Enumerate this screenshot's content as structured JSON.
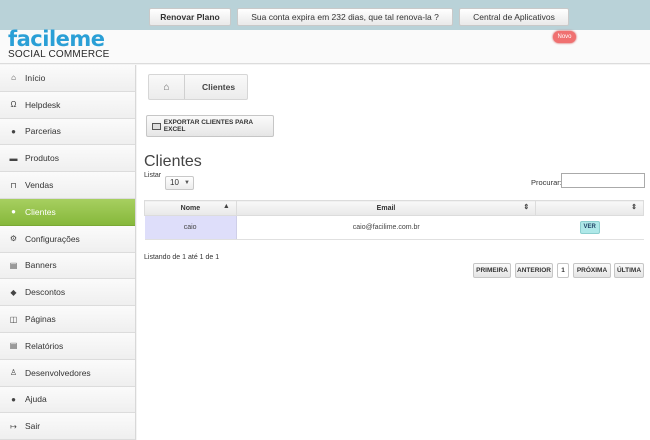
{
  "logo": {
    "main": "facileme",
    "sub": "SOCIAL COMMERCE"
  },
  "header": {
    "plan_button": "Renovar Plano",
    "expira_button": "Sua conta expira em 232 dias, que tal renova-la ?",
    "apps_button": "Central de Aplicativos",
    "new_badge": "Novo"
  },
  "sidebar": {
    "items": [
      {
        "label": "Início",
        "icon": "home-icon"
      },
      {
        "label": "Helpdesk",
        "icon": "headphones-icon"
      },
      {
        "label": "Parcerias",
        "icon": "info-icon"
      },
      {
        "label": "Produtos",
        "icon": "folder-icon"
      },
      {
        "label": "Vendas",
        "icon": "cart-icon"
      },
      {
        "label": "Clientes",
        "icon": "users-icon",
        "active": true
      },
      {
        "label": "Configurações",
        "icon": "gears-icon"
      },
      {
        "label": "Banners",
        "icon": "banner-icon"
      },
      {
        "label": "Descontos",
        "icon": "tag-icon"
      },
      {
        "label": "Páginas",
        "icon": "pages-icon"
      },
      {
        "label": "Relatórios",
        "icon": "report-icon"
      },
      {
        "label": "Desenvolvedores",
        "icon": "developer-icon"
      },
      {
        "label": "Ajuda",
        "icon": "help-icon"
      },
      {
        "label": "Sair",
        "icon": "exit-icon"
      }
    ]
  },
  "breadcrumb": {
    "current": "Clientes"
  },
  "toolbar": {
    "export_label": "EXPORTAR CLIENTES PARA EXCEL"
  },
  "page": {
    "title": "Clientes",
    "listar_label": "Listar",
    "listar_value": "10",
    "search_label": "Procurar:",
    "search_value": ""
  },
  "table": {
    "columns": [
      "Nome",
      "Email",
      ""
    ],
    "rows": [
      {
        "nome": "caio",
        "email": "caio@facilime.com.br",
        "action": "VER"
      }
    ]
  },
  "footer": {
    "info": "Listando de 1 até 1 de 1",
    "first": "PRIMEIRA",
    "prev": "ANTERIOR",
    "page": "1",
    "next": "PRÓXIMA",
    "last": "ÚLTIMA"
  },
  "colors": {
    "accent": "#2a9fd6",
    "active_nav": "#96c24c",
    "topbar": "#b9d2d8"
  }
}
